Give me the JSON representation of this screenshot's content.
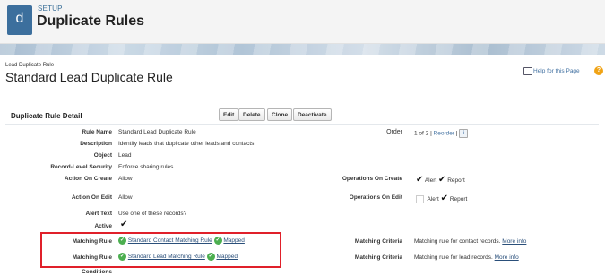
{
  "header": {
    "logo_letter": "d",
    "setup_label": "SETUP",
    "title": "Duplicate Rules"
  },
  "record": {
    "subtitle": "Lead Duplicate Rule",
    "title": "Standard Lead Duplicate Rule",
    "help_link": "Help for this Page"
  },
  "detail": {
    "section_title": "Duplicate Rule Detail",
    "buttons": {
      "edit": "Edit",
      "delete": "Delete",
      "clone": "Clone",
      "deactivate": "Deactivate"
    },
    "fields": {
      "rule_name_label": "Rule Name",
      "rule_name_value": "Standard Lead Duplicate Rule",
      "description_label": "Description",
      "description_value": "Identify leads that duplicate other leads and contacts",
      "object_label": "Object",
      "object_value": "Lead",
      "record_level_security_label": "Record-Level Security",
      "record_level_security_value": "Enforce sharing rules",
      "action_on_create_label": "Action On Create",
      "action_on_create_value": "Allow",
      "action_on_edit_label": "Action On Edit",
      "action_on_edit_value": "Allow",
      "alert_text_label": "Alert Text",
      "alert_text_value": "Use one of these records?",
      "active_label": "Active",
      "active_value": "✔",
      "order_label": "Order",
      "order_value": "1 of 2 |",
      "reorder_link": "Reorder",
      "order_sep": "|",
      "info_icon_text": "i",
      "operations_on_create_label": "Operations On Create",
      "operations_on_edit_label": "Operations On Edit",
      "alert_label": "Alert",
      "report_label": "Report",
      "tick": "✔",
      "conditions_label": "Conditions"
    },
    "matching_rules": [
      {
        "label": "Matching Rule",
        "name": "Standard Contact Matching Rule",
        "status": "Mapped",
        "criteria_label": "Matching Criteria",
        "criteria_value": "Matching rule for contact records.",
        "more_info": "More info"
      },
      {
        "label": "Matching Rule",
        "name": "Standard Lead Matching Rule",
        "status": "Mapped",
        "criteria_label": "Matching Criteria",
        "criteria_value": "Matching rule for lead records.",
        "more_info": "More info"
      }
    ]
  },
  "colors": {
    "header_bg": "#f4f4f4",
    "logo_bg": "#3c6f9d",
    "highlight_border": "#e0202a",
    "check_green": "#4caf50",
    "link": "#2a4f7a"
  }
}
